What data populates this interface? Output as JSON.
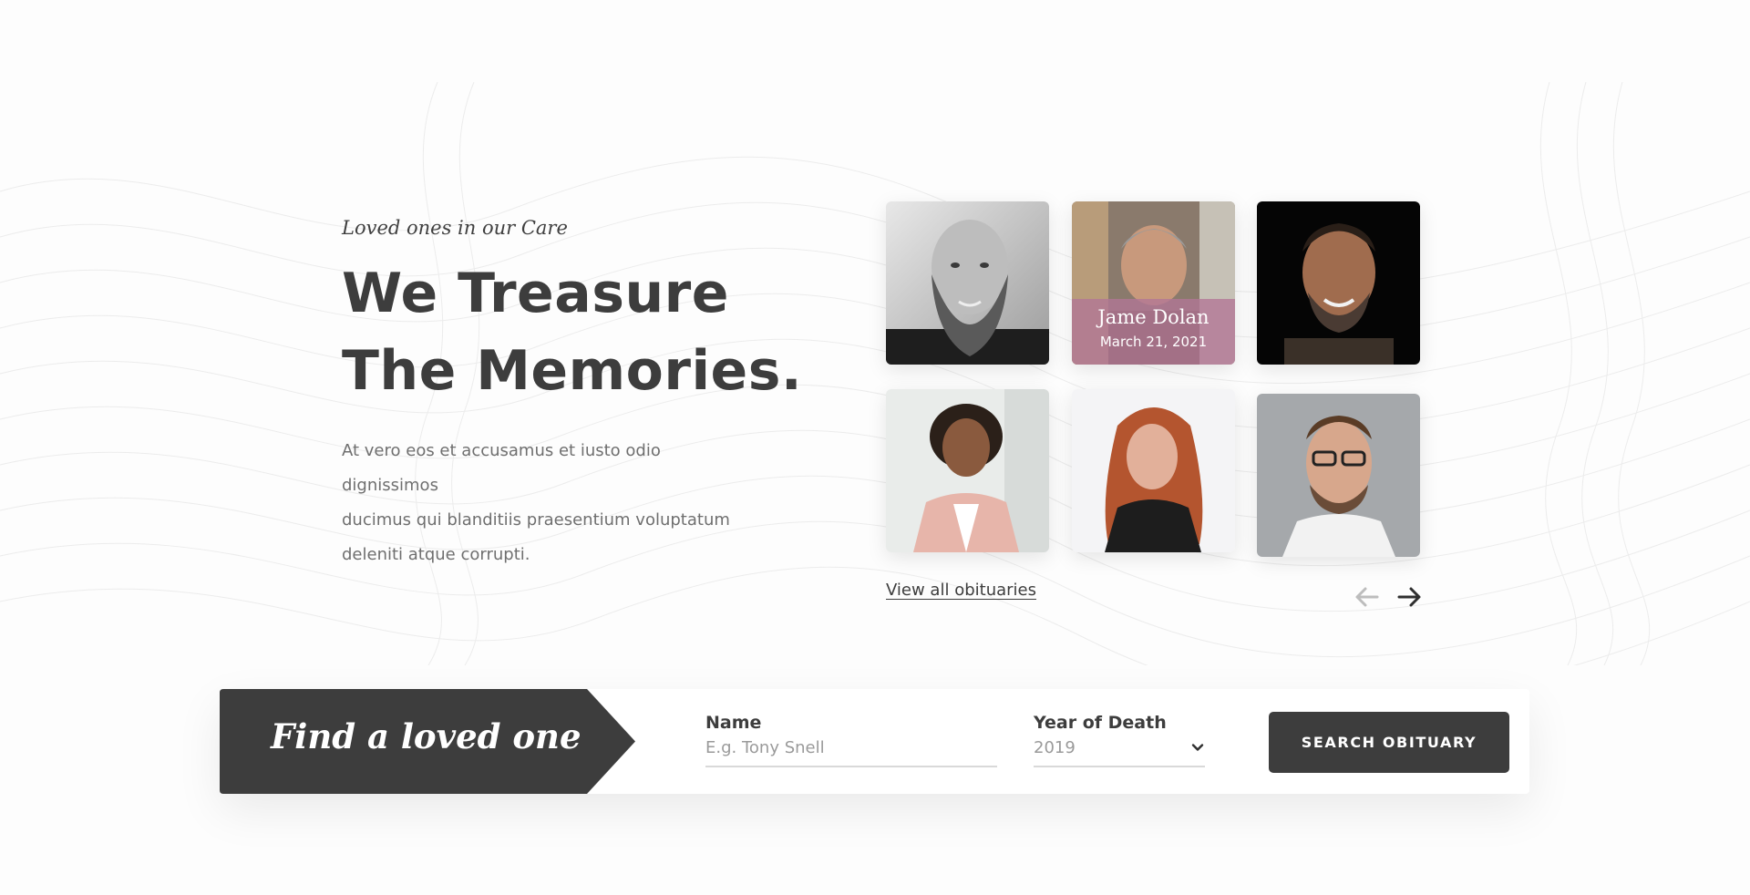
{
  "intro": {
    "eyebrow": "Loved ones in our Care",
    "headline_line1": "We Treasure",
    "headline_line2": "The Memories.",
    "lead_line1": "At vero eos et accusamus et iusto odio dignissimos",
    "lead_line2": "ducimus qui blanditiis praesentium voluptatum",
    "lead_line3": "deleniti atque corrupti."
  },
  "gallery": {
    "featured": {
      "name": "Jame Dolan",
      "date": "March 21, 2021"
    },
    "view_all_label": "View all obituaries",
    "prev_icon": "arrow-left-icon",
    "next_icon": "arrow-right-icon"
  },
  "search": {
    "banner_title": "Find a loved one",
    "name_label": "Name",
    "name_placeholder": "E.g. Tony Snell",
    "name_value": "",
    "year_label": "Year of Death",
    "year_value": "2019",
    "submit_label": "SEARCH OBITUARY"
  },
  "colors": {
    "dark": "#3d3d3d",
    "caption_overlay": "#b27696",
    "muted_text": "#6f6f6f",
    "background": "#fdfdfd"
  }
}
